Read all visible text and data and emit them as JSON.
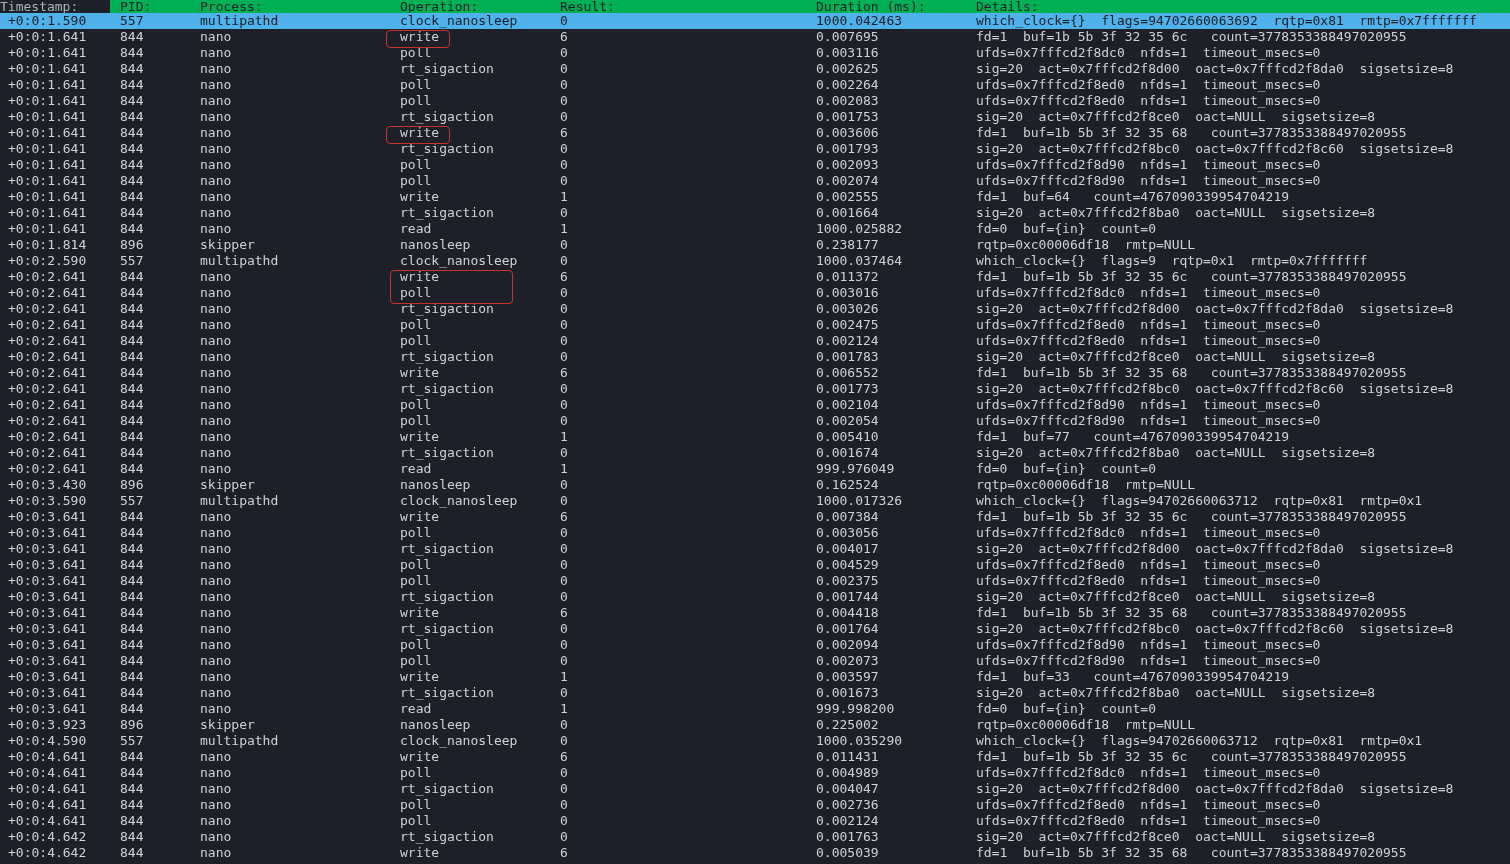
{
  "table": {
    "columns": [
      {
        "label": "Timestamp:",
        "sorted": true
      },
      {
        "label": "PID:",
        "sorted": false
      },
      {
        "label": "Process:",
        "sorted": false
      },
      {
        "label": "Operation:",
        "sorted": false
      },
      {
        "label": "Result:",
        "sorted": false
      },
      {
        "label": "Duration (ms):",
        "sorted": false
      },
      {
        "label": "Details:",
        "sorted": false
      }
    ],
    "rows": [
      {
        "timestamp": "+0:0:1.590",
        "pid": "557",
        "process": "multipathd",
        "operation": "clock_nanosleep",
        "result": "0",
        "duration": "1000.042463",
        "details": "which_clock={}  flags=94702660063692  rqtp=0x81  rmtp=0x7fffffff",
        "selected": true,
        "circled": false
      },
      {
        "timestamp": "+0:0:1.641",
        "pid": "844",
        "process": "nano",
        "operation": "write",
        "result": "6",
        "duration": "0.007695",
        "details": "fd=1  buf=1b 5b 3f 32 35 6c   count=3778353388497020955",
        "selected": false,
        "circled": true
      },
      {
        "timestamp": "+0:0:1.641",
        "pid": "844",
        "process": "nano",
        "operation": "poll",
        "result": "0",
        "duration": "0.003116",
        "details": "ufds=0x7fffcd2f8dc0  nfds=1  timeout_msecs=0",
        "selected": false,
        "circled": false
      },
      {
        "timestamp": "+0:0:1.641",
        "pid": "844",
        "process": "nano",
        "operation": "rt_sigaction",
        "result": "0",
        "duration": "0.002625",
        "details": "sig=20  act=0x7fffcd2f8d00  oact=0x7fffcd2f8da0  sigsetsize=8",
        "selected": false,
        "circled": false
      },
      {
        "timestamp": "+0:0:1.641",
        "pid": "844",
        "process": "nano",
        "operation": "poll",
        "result": "0",
        "duration": "0.002264",
        "details": "ufds=0x7fffcd2f8ed0  nfds=1  timeout_msecs=0",
        "selected": false,
        "circled": false
      },
      {
        "timestamp": "+0:0:1.641",
        "pid": "844",
        "process": "nano",
        "operation": "poll",
        "result": "0",
        "duration": "0.002083",
        "details": "ufds=0x7fffcd2f8ed0  nfds=1  timeout_msecs=0",
        "selected": false,
        "circled": false
      },
      {
        "timestamp": "+0:0:1.641",
        "pid": "844",
        "process": "nano",
        "operation": "rt_sigaction",
        "result": "0",
        "duration": "0.001753",
        "details": "sig=20  act=0x7fffcd2f8ce0  oact=NULL  sigsetsize=8",
        "selected": false,
        "circled": false
      },
      {
        "timestamp": "+0:0:1.641",
        "pid": "844",
        "process": "nano",
        "operation": "write",
        "result": "6",
        "duration": "0.003606",
        "details": "fd=1  buf=1b 5b 3f 32 35 68   count=3778353388497020955",
        "selected": false,
        "circled": true
      },
      {
        "timestamp": "+0:0:1.641",
        "pid": "844",
        "process": "nano",
        "operation": "rt_sigaction",
        "result": "0",
        "duration": "0.001793",
        "details": "sig=20  act=0x7fffcd2f8bc0  oact=0x7fffcd2f8c60  sigsetsize=8",
        "selected": false,
        "circled": false
      },
      {
        "timestamp": "+0:0:1.641",
        "pid": "844",
        "process": "nano",
        "operation": "poll",
        "result": "0",
        "duration": "0.002093",
        "details": "ufds=0x7fffcd2f8d90  nfds=1  timeout_msecs=0",
        "selected": false,
        "circled": false
      },
      {
        "timestamp": "+0:0:1.641",
        "pid": "844",
        "process": "nano",
        "operation": "poll",
        "result": "0",
        "duration": "0.002074",
        "details": "ufds=0x7fffcd2f8d90  nfds=1  timeout_msecs=0",
        "selected": false,
        "circled": false
      },
      {
        "timestamp": "+0:0:1.641",
        "pid": "844",
        "process": "nano",
        "operation": "write",
        "result": "1",
        "duration": "0.002555",
        "details": "fd=1  buf=64   count=4767090339954704219",
        "selected": false,
        "circled": false
      },
      {
        "timestamp": "+0:0:1.641",
        "pid": "844",
        "process": "nano",
        "operation": "rt_sigaction",
        "result": "0",
        "duration": "0.001664",
        "details": "sig=20  act=0x7fffcd2f8ba0  oact=NULL  sigsetsize=8",
        "selected": false,
        "circled": false
      },
      {
        "timestamp": "+0:0:1.641",
        "pid": "844",
        "process": "nano",
        "operation": "read",
        "result": "1",
        "duration": "1000.025882",
        "details": "fd=0  buf={in}  count=0",
        "selected": false,
        "circled": false
      },
      {
        "timestamp": "+0:0:1.814",
        "pid": "896",
        "process": "skipper",
        "operation": "nanosleep",
        "result": "0",
        "duration": "0.238177",
        "details": "rqtp=0xc00006df18  rmtp=NULL",
        "selected": false,
        "circled": false
      },
      {
        "timestamp": "+0:0:2.590",
        "pid": "557",
        "process": "multipathd",
        "operation": "clock_nanosleep",
        "result": "0",
        "duration": "1000.037464",
        "details": "which_clock={}  flags=9  rqtp=0x1  rmtp=0x7fffffff",
        "selected": false,
        "circled": false
      },
      {
        "timestamp": "+0:0:2.641",
        "pid": "844",
        "process": "nano",
        "operation": "write",
        "result": "6",
        "duration": "0.011372",
        "details": "fd=1  buf=1b 5b 3f 32 35 6c   count=3778353388497020955",
        "selected": false,
        "circled": true
      },
      {
        "timestamp": "+0:0:2.641",
        "pid": "844",
        "process": "nano",
        "operation": "poll",
        "result": "0",
        "duration": "0.003016",
        "details": "ufds=0x7fffcd2f8dc0  nfds=1  timeout_msecs=0",
        "selected": false,
        "circled": true
      },
      {
        "timestamp": "+0:0:2.641",
        "pid": "844",
        "process": "nano",
        "operation": "rt_sigaction",
        "result": "0",
        "duration": "0.003026",
        "details": "sig=20  act=0x7fffcd2f8d00  oact=0x7fffcd2f8da0  sigsetsize=8",
        "selected": false,
        "circled": false
      },
      {
        "timestamp": "+0:0:2.641",
        "pid": "844",
        "process": "nano",
        "operation": "poll",
        "result": "0",
        "duration": "0.002475",
        "details": "ufds=0x7fffcd2f8ed0  nfds=1  timeout_msecs=0",
        "selected": false,
        "circled": false
      },
      {
        "timestamp": "+0:0:2.641",
        "pid": "844",
        "process": "nano",
        "operation": "poll",
        "result": "0",
        "duration": "0.002124",
        "details": "ufds=0x7fffcd2f8ed0  nfds=1  timeout_msecs=0",
        "selected": false,
        "circled": false
      },
      {
        "timestamp": "+0:0:2.641",
        "pid": "844",
        "process": "nano",
        "operation": "rt_sigaction",
        "result": "0",
        "duration": "0.001783",
        "details": "sig=20  act=0x7fffcd2f8ce0  oact=NULL  sigsetsize=8",
        "selected": false,
        "circled": false
      },
      {
        "timestamp": "+0:0:2.641",
        "pid": "844",
        "process": "nano",
        "operation": "write",
        "result": "6",
        "duration": "0.006552",
        "details": "fd=1  buf=1b 5b 3f 32 35 68   count=3778353388497020955",
        "selected": false,
        "circled": false
      },
      {
        "timestamp": "+0:0:2.641",
        "pid": "844",
        "process": "nano",
        "operation": "rt_sigaction",
        "result": "0",
        "duration": "0.001773",
        "details": "sig=20  act=0x7fffcd2f8bc0  oact=0x7fffcd2f8c60  sigsetsize=8",
        "selected": false,
        "circled": false
      },
      {
        "timestamp": "+0:0:2.641",
        "pid": "844",
        "process": "nano",
        "operation": "poll",
        "result": "0",
        "duration": "0.002104",
        "details": "ufds=0x7fffcd2f8d90  nfds=1  timeout_msecs=0",
        "selected": false,
        "circled": false
      },
      {
        "timestamp": "+0:0:2.641",
        "pid": "844",
        "process": "nano",
        "operation": "poll",
        "result": "0",
        "duration": "0.002054",
        "details": "ufds=0x7fffcd2f8d90  nfds=1  timeout_msecs=0",
        "selected": false,
        "circled": false
      },
      {
        "timestamp": "+0:0:2.641",
        "pid": "844",
        "process": "nano",
        "operation": "write",
        "result": "1",
        "duration": "0.005410",
        "details": "fd=1  buf=77   count=4767090339954704219",
        "selected": false,
        "circled": false
      },
      {
        "timestamp": "+0:0:2.641",
        "pid": "844",
        "process": "nano",
        "operation": "rt_sigaction",
        "result": "0",
        "duration": "0.001674",
        "details": "sig=20  act=0x7fffcd2f8ba0  oact=NULL  sigsetsize=8",
        "selected": false,
        "circled": false
      },
      {
        "timestamp": "+0:0:2.641",
        "pid": "844",
        "process": "nano",
        "operation": "read",
        "result": "1",
        "duration": "999.976049",
        "details": "fd=0  buf={in}  count=0",
        "selected": false,
        "circled": false
      },
      {
        "timestamp": "+0:0:3.430",
        "pid": "896",
        "process": "skipper",
        "operation": "nanosleep",
        "result": "0",
        "duration": "0.162524",
        "details": "rqtp=0xc00006df18  rmtp=NULL",
        "selected": false,
        "circled": false
      },
      {
        "timestamp": "+0:0:3.590",
        "pid": "557",
        "process": "multipathd",
        "operation": "clock_nanosleep",
        "result": "0",
        "duration": "1000.017326",
        "details": "which_clock={}  flags=94702660063712  rqtp=0x81  rmtp=0x1",
        "selected": false,
        "circled": false
      },
      {
        "timestamp": "+0:0:3.641",
        "pid": "844",
        "process": "nano",
        "operation": "write",
        "result": "6",
        "duration": "0.007384",
        "details": "fd=1  buf=1b 5b 3f 32 35 6c   count=3778353388497020955",
        "selected": false,
        "circled": false
      },
      {
        "timestamp": "+0:0:3.641",
        "pid": "844",
        "process": "nano",
        "operation": "poll",
        "result": "0",
        "duration": "0.003056",
        "details": "ufds=0x7fffcd2f8dc0  nfds=1  timeout_msecs=0",
        "selected": false,
        "circled": false
      },
      {
        "timestamp": "+0:0:3.641",
        "pid": "844",
        "process": "nano",
        "operation": "rt_sigaction",
        "result": "0",
        "duration": "0.004017",
        "details": "sig=20  act=0x7fffcd2f8d00  oact=0x7fffcd2f8da0  sigsetsize=8",
        "selected": false,
        "circled": false
      },
      {
        "timestamp": "+0:0:3.641",
        "pid": "844",
        "process": "nano",
        "operation": "poll",
        "result": "0",
        "duration": "0.004529",
        "details": "ufds=0x7fffcd2f8ed0  nfds=1  timeout_msecs=0",
        "selected": false,
        "circled": false
      },
      {
        "timestamp": "+0:0:3.641",
        "pid": "844",
        "process": "nano",
        "operation": "poll",
        "result": "0",
        "duration": "0.002375",
        "details": "ufds=0x7fffcd2f8ed0  nfds=1  timeout_msecs=0",
        "selected": false,
        "circled": false
      },
      {
        "timestamp": "+0:0:3.641",
        "pid": "844",
        "process": "nano",
        "operation": "rt_sigaction",
        "result": "0",
        "duration": "0.001744",
        "details": "sig=20  act=0x7fffcd2f8ce0  oact=NULL  sigsetsize=8",
        "selected": false,
        "circled": false
      },
      {
        "timestamp": "+0:0:3.641",
        "pid": "844",
        "process": "nano",
        "operation": "write",
        "result": "6",
        "duration": "0.004418",
        "details": "fd=1  buf=1b 5b 3f 32 35 68   count=3778353388497020955",
        "selected": false,
        "circled": false
      },
      {
        "timestamp": "+0:0:3.641",
        "pid": "844",
        "process": "nano",
        "operation": "rt_sigaction",
        "result": "0",
        "duration": "0.001764",
        "details": "sig=20  act=0x7fffcd2f8bc0  oact=0x7fffcd2f8c60  sigsetsize=8",
        "selected": false,
        "circled": false
      },
      {
        "timestamp": "+0:0:3.641",
        "pid": "844",
        "process": "nano",
        "operation": "poll",
        "result": "0",
        "duration": "0.002094",
        "details": "ufds=0x7fffcd2f8d90  nfds=1  timeout_msecs=0",
        "selected": false,
        "circled": false
      },
      {
        "timestamp": "+0:0:3.641",
        "pid": "844",
        "process": "nano",
        "operation": "poll",
        "result": "0",
        "duration": "0.002073",
        "details": "ufds=0x7fffcd2f8d90  nfds=1  timeout_msecs=0",
        "selected": false,
        "circled": false
      },
      {
        "timestamp": "+0:0:3.641",
        "pid": "844",
        "process": "nano",
        "operation": "write",
        "result": "1",
        "duration": "0.003597",
        "details": "fd=1  buf=33   count=4767090339954704219",
        "selected": false,
        "circled": false
      },
      {
        "timestamp": "+0:0:3.641",
        "pid": "844",
        "process": "nano",
        "operation": "rt_sigaction",
        "result": "0",
        "duration": "0.001673",
        "details": "sig=20  act=0x7fffcd2f8ba0  oact=NULL  sigsetsize=8",
        "selected": false,
        "circled": false
      },
      {
        "timestamp": "+0:0:3.641",
        "pid": "844",
        "process": "nano",
        "operation": "read",
        "result": "1",
        "duration": "999.998200",
        "details": "fd=0  buf={in}  count=0",
        "selected": false,
        "circled": false
      },
      {
        "timestamp": "+0:0:3.923",
        "pid": "896",
        "process": "skipper",
        "operation": "nanosleep",
        "result": "0",
        "duration": "0.225002",
        "details": "rqtp=0xc00006df18  rmtp=NULL",
        "selected": false,
        "circled": false
      },
      {
        "timestamp": "+0:0:4.590",
        "pid": "557",
        "process": "multipathd",
        "operation": "clock_nanosleep",
        "result": "0",
        "duration": "1000.035290",
        "details": "which_clock={}  flags=94702660063712  rqtp=0x81  rmtp=0x1",
        "selected": false,
        "circled": false
      },
      {
        "timestamp": "+0:0:4.641",
        "pid": "844",
        "process": "nano",
        "operation": "write",
        "result": "6",
        "duration": "0.011431",
        "details": "fd=1  buf=1b 5b 3f 32 35 6c   count=3778353388497020955",
        "selected": false,
        "circled": false
      },
      {
        "timestamp": "+0:0:4.641",
        "pid": "844",
        "process": "nano",
        "operation": "poll",
        "result": "0",
        "duration": "0.004989",
        "details": "ufds=0x7fffcd2f8dc0  nfds=1  timeout_msecs=0",
        "selected": false,
        "circled": false
      },
      {
        "timestamp": "+0:0:4.641",
        "pid": "844",
        "process": "nano",
        "operation": "rt_sigaction",
        "result": "0",
        "duration": "0.004047",
        "details": "sig=20  act=0x7fffcd2f8d00  oact=0x7fffcd2f8da0  sigsetsize=8",
        "selected": false,
        "circled": false
      },
      {
        "timestamp": "+0:0:4.641",
        "pid": "844",
        "process": "nano",
        "operation": "poll",
        "result": "0",
        "duration": "0.002736",
        "details": "ufds=0x7fffcd2f8ed0  nfds=1  timeout_msecs=0",
        "selected": false,
        "circled": false
      },
      {
        "timestamp": "+0:0:4.641",
        "pid": "844",
        "process": "nano",
        "operation": "poll",
        "result": "0",
        "duration": "0.002124",
        "details": "ufds=0x7fffcd2f8ed0  nfds=1  timeout_msecs=0",
        "selected": false,
        "circled": false
      },
      {
        "timestamp": "+0:0:4.642",
        "pid": "844",
        "process": "nano",
        "operation": "rt_sigaction",
        "result": "0",
        "duration": "0.001763",
        "details": "sig=20  act=0x7fffcd2f8ce0  oact=NULL  sigsetsize=8",
        "selected": false,
        "circled": false
      },
      {
        "timestamp": "+0:0:4.642",
        "pid": "844",
        "process": "nano",
        "operation": "write",
        "result": "6",
        "duration": "0.005039",
        "details": "fd=1  buf=1b 5b 3f 32 35 68   count=3778353388497020955",
        "selected": false,
        "circled": false
      }
    ]
  }
}
